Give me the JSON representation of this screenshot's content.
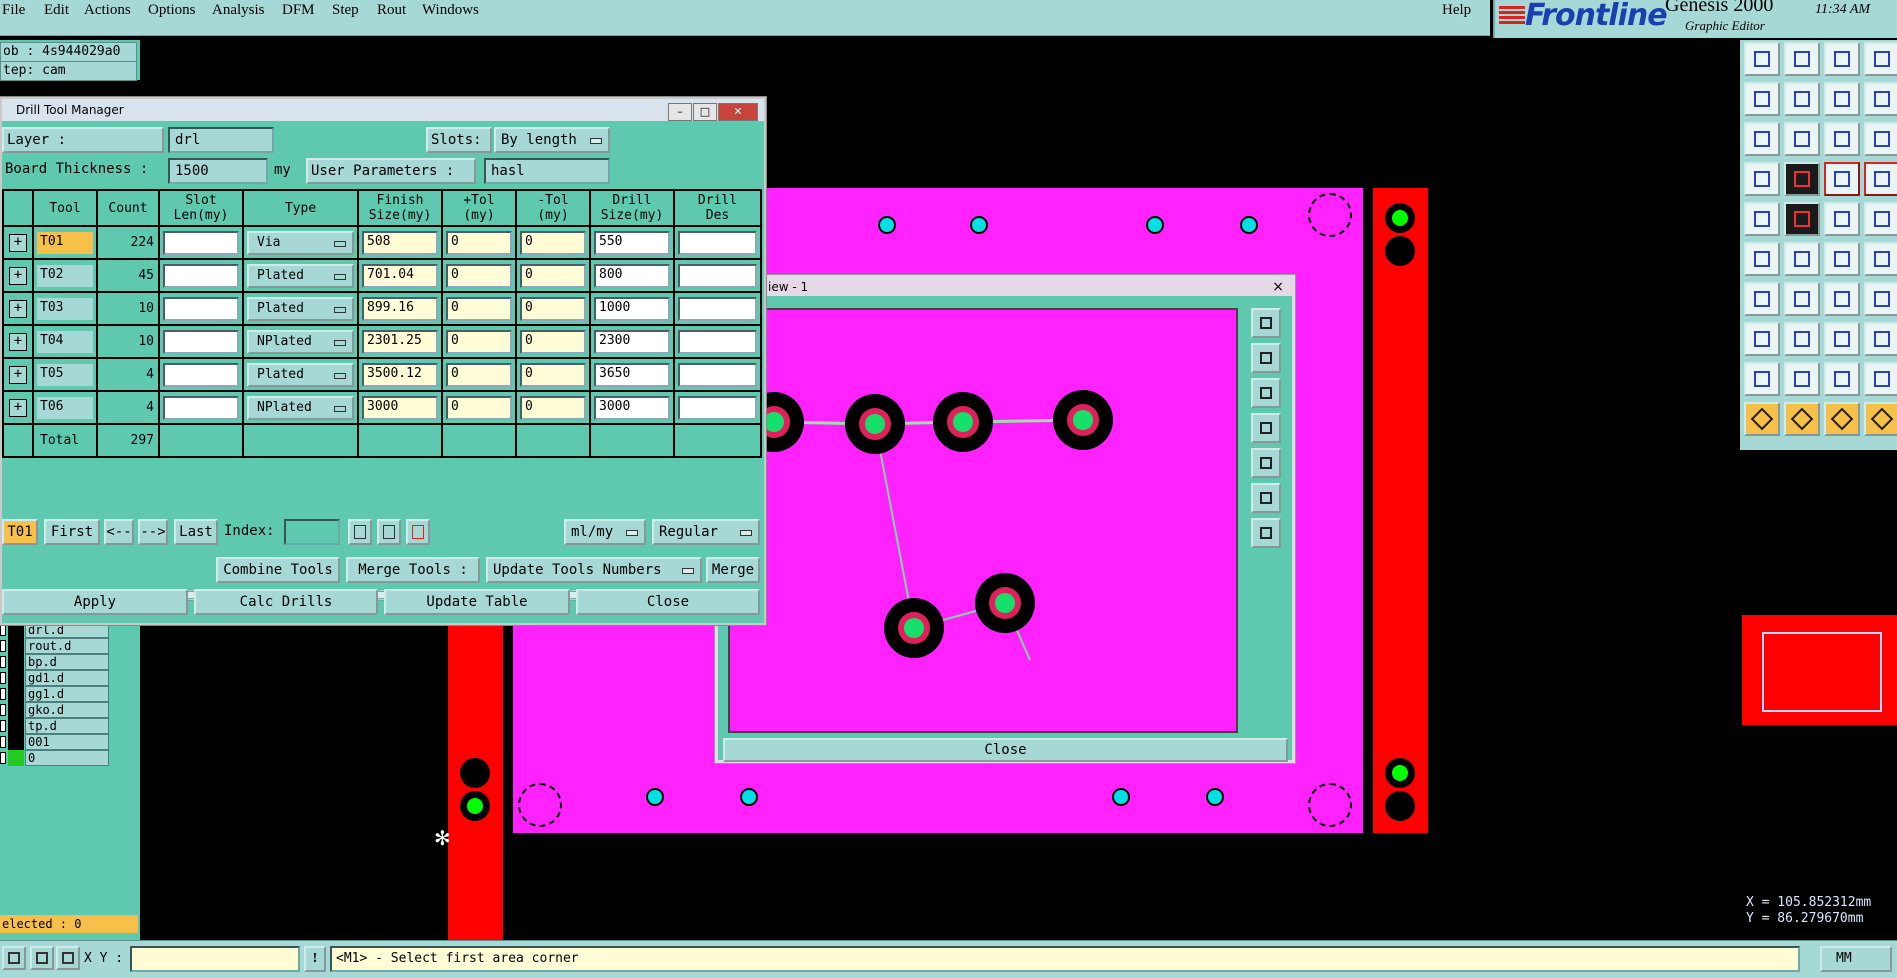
{
  "menubar": {
    "items": [
      "File",
      "Edit",
      "Actions",
      "Options",
      "Analysis",
      "DFM",
      "Step",
      "Rout",
      "Windows"
    ],
    "help": "Help"
  },
  "brand": {
    "logo": "Frontline",
    "product": "Genesis 2000",
    "subtitle": "Graphic Editor",
    "time": "11:34 AM"
  },
  "info": {
    "job": "ob : 4s944029a0",
    "step": "tep: cam"
  },
  "layers": [
    {
      "name": "drl.d",
      "color": "#000000"
    },
    {
      "name": "rout.d",
      "color": "#000000"
    },
    {
      "name": "bp.d",
      "color": "#000000"
    },
    {
      "name": "gd1.d",
      "color": "#000000"
    },
    {
      "name": "gg1.d",
      "color": "#000000"
    },
    {
      "name": "gko.d",
      "color": "#000000"
    },
    {
      "name": "tp.d",
      "color": "#000000"
    },
    {
      "name": "001",
      "color": "#000000"
    },
    {
      "name": "0",
      "color": "#22cc22"
    }
  ],
  "selected": "elected : 0",
  "coords": {
    "x": "X = 105.852312mm",
    "y": "Y =  86.279670mm"
  },
  "view_window": {
    "title": "iew - 1",
    "close_x": "×",
    "close": "Close"
  },
  "dtm": {
    "title": "Drill Tool Manager",
    "min": "–",
    "max": "□",
    "close_x": "✕",
    "layer_label": "Layer            :",
    "layer_value": "drl",
    "slots_label": "Slots:",
    "slots_value": "By length",
    "thickness_label": "Board Thickness :",
    "thickness_value": "1500",
    "thickness_unit": "my",
    "user_params_label": "User Parameters :",
    "user_params_value": "hasl",
    "headers": [
      "",
      "Tool",
      "Count",
      "Slot\nLen(my)",
      "Type",
      "Finish\nSize(my)",
      "+Tol\n(my)",
      "-Tol\n(my)",
      "Drill\nSize(my)",
      "Drill\nDes"
    ],
    "rows": [
      {
        "tool": "T01",
        "count": "224",
        "slot": "",
        "type": "Via",
        "finish": "508",
        "ptol": "0",
        "ntol": "0",
        "drill": "550",
        "des": ""
      },
      {
        "tool": "T02",
        "count": "45",
        "slot": "",
        "type": "Plated",
        "finish": "701.04",
        "ptol": "0",
        "ntol": "0",
        "drill": "800",
        "des": ""
      },
      {
        "tool": "T03",
        "count": "10",
        "slot": "",
        "type": "Plated",
        "finish": "899.16",
        "ptol": "0",
        "ntol": "0",
        "drill": "1000",
        "des": ""
      },
      {
        "tool": "T04",
        "count": "10",
        "slot": "",
        "type": "NPlated",
        "finish": "2301.25",
        "ptol": "0",
        "ntol": "0",
        "drill": "2300",
        "des": ""
      },
      {
        "tool": "T05",
        "count": "4",
        "slot": "",
        "type": "Plated",
        "finish": "3500.12",
        "ptol": "0",
        "ntol": "0",
        "drill": "3650",
        "des": ""
      },
      {
        "tool": "T06",
        "count": "4",
        "slot": "",
        "type": "NPlated",
        "finish": "3000",
        "ptol": "0",
        "ntol": "0",
        "drill": "3000",
        "des": ""
      }
    ],
    "total_label": "Total",
    "total_count": "297",
    "nav": {
      "current": "T01",
      "first": "First",
      "prev": "<--",
      "next": "-->",
      "last": "Last",
      "index_label": "Index:",
      "units": "ml/my",
      "mode": "Regular"
    },
    "actions": {
      "combine": "Combine Tools",
      "merge_label": "Merge Tools :",
      "update_numbers": "Update Tools Numbers",
      "merge": "Merge",
      "apply": "Apply",
      "calc": "Calc Drills",
      "update_table": "Update Table",
      "close": "Close"
    }
  },
  "status": {
    "xy_label": "X Y :",
    "excl": "!",
    "prompt": "<M1> - Select first area corner",
    "units": "MM"
  }
}
